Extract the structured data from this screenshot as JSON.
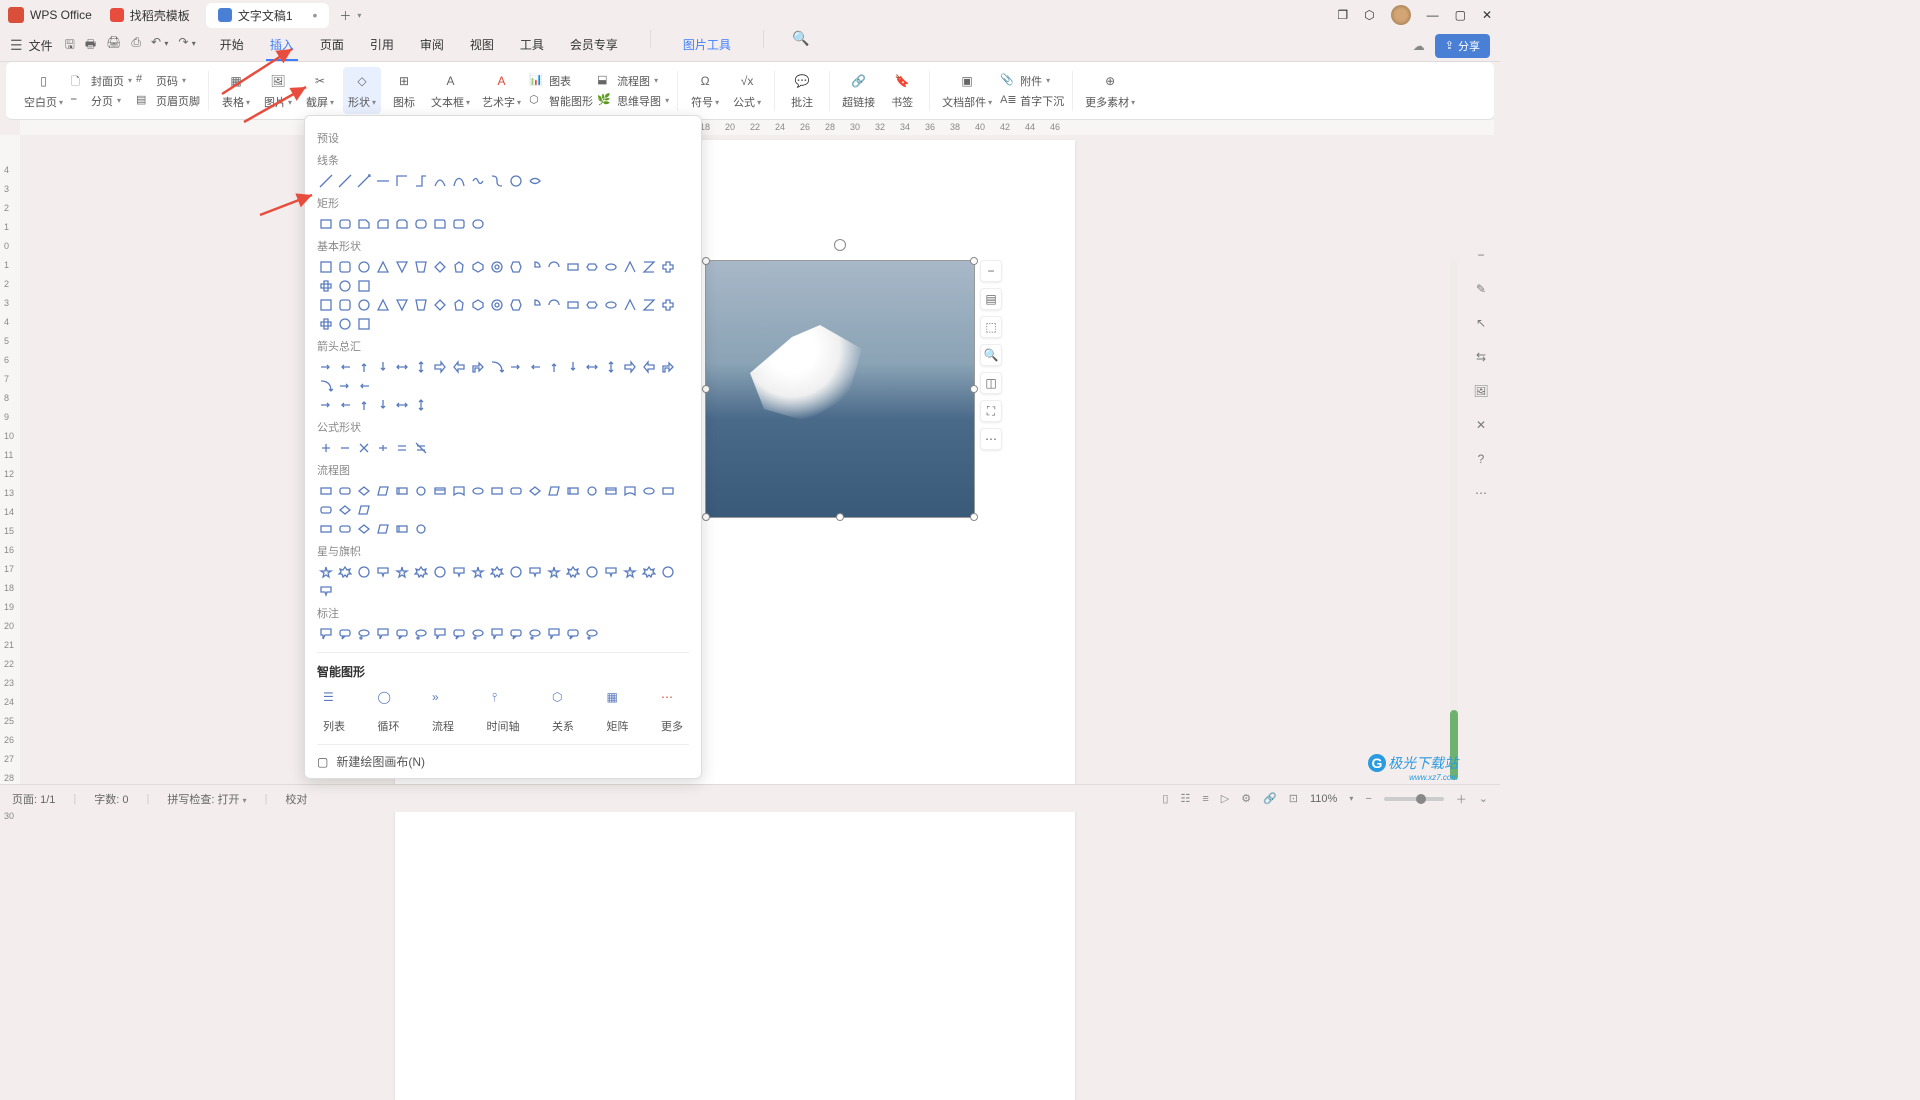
{
  "app_name": "WPS Office",
  "tabs": [
    {
      "label": "找稻壳模板"
    },
    {
      "label": "文字文稿1"
    }
  ],
  "file_menu": "文件",
  "menu": {
    "start": "开始",
    "insert": "插入",
    "page": "页面",
    "reference": "引用",
    "review": "审阅",
    "view": "视图",
    "tools": "工具",
    "member": "会员专享",
    "pic_tools": "图片工具"
  },
  "ribbon": {
    "blank_page": "空白页",
    "cover": "封面页",
    "page_num": "页码",
    "page_break": "分页",
    "header_footer": "页眉页脚",
    "table": "表格",
    "picture": "图片",
    "screenshot": "截屏",
    "shape": "形状",
    "icon": "图标",
    "textbox": "文本框",
    "wordart": "艺术字",
    "chart": "图表",
    "flowchart": "流程图",
    "smartart": "智能图形",
    "mindmap": "思维导图",
    "symbol": "符号",
    "formula": "公式",
    "comment": "批注",
    "hyperlink": "超链接",
    "bookmark": "书签",
    "doc_parts": "文档部件",
    "dropcap": "首字下沉",
    "attachment": "附件",
    "more": "更多素材"
  },
  "share": "分享",
  "shapes": {
    "preset": "预设",
    "lines": "线条",
    "rect": "矩形",
    "basic": "基本形状",
    "arrows": "箭头总汇",
    "equation": "公式形状",
    "flow": "流程图",
    "stars": "星与旗帜",
    "callouts": "标注",
    "smart": "智能图形",
    "smart_items": {
      "list": "列表",
      "cycle": "循环",
      "process": "流程",
      "timeline": "时间轴",
      "relation": "关系",
      "matrix": "矩阵",
      "more": "更多"
    },
    "new_canvas": "新建绘图画布(N)"
  },
  "status": {
    "page": "页面: 1/1",
    "words": "字数: 0",
    "spell": "拼写检查: 打开",
    "proof": "校对",
    "zoom": "110%"
  },
  "ruler_h": [
    18,
    20,
    22,
    24,
    26,
    28,
    30,
    32,
    34,
    36,
    38,
    40,
    42,
    44,
    46
  ],
  "watermark": {
    "main": "极光下载站",
    "sub": "www.xz7.com"
  }
}
